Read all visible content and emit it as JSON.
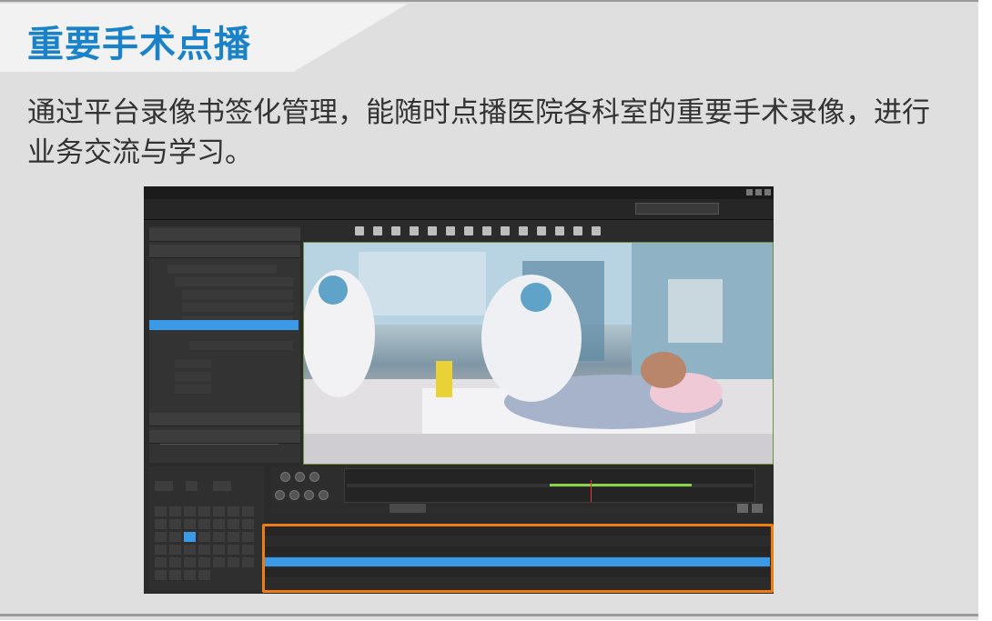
{
  "page": {
    "title": "重要手术点播",
    "description": "通过平台录像书签化管理，能随时点播医院各科室的重要手术录像，进行业务交流与学习。",
    "colors": {
      "title": "#1a82c8",
      "highlight": "#f07d12",
      "selection": "#3b9ae8",
      "timeline_recorded": "#8ad24a"
    }
  },
  "app": {
    "tree_headers": [
      "",
      "",
      "",
      ""
    ],
    "calendar_selected_day": "",
    "tabs": [
      "",
      "",
      ""
    ],
    "table_columns": [
      "",
      "",
      "",
      ""
    ],
    "rows": [
      {
        "c1": "",
        "c2": "",
        "c3": ""
      },
      {
        "c1": "",
        "c2": "",
        "c3": ""
      },
      {
        "c1": "",
        "c2": "",
        "c3": ""
      },
      {
        "c1": "",
        "c2": "",
        "c3": ""
      },
      {
        "c1": "",
        "c2": "",
        "c3": ""
      },
      {
        "c1": "",
        "c2": "",
        "c3": ""
      }
    ],
    "selected_row_index": 3,
    "timeline": {
      "recorded_from": 0.5,
      "recorded_to": 0.85,
      "playhead": 0.6
    }
  }
}
